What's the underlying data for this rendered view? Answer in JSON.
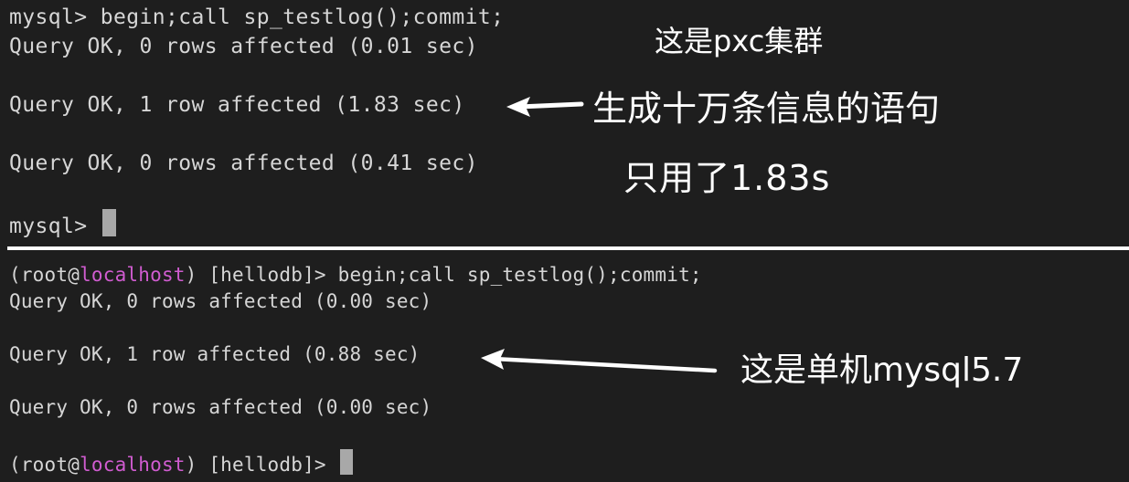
{
  "top_terminal": {
    "prompt": "mysql> ",
    "command": "begin;call sp_testlog();commit;",
    "lines": [
      "Query OK, 0 rows affected (0.01 sec)",
      "Query OK, 1 row affected (1.83 sec)",
      "Query OK, 0 rows affected (0.41 sec)"
    ],
    "final_prompt": "mysql> "
  },
  "bottom_terminal": {
    "prompt_open": "(root@",
    "host": "localhost",
    "prompt_close": ") [hellodb]> ",
    "command": "begin;call sp_testlog();commit;",
    "lines": [
      "Query OK, 0 rows affected (0.00 sec)",
      "Query OK, 1 row affected (0.88 sec)",
      "Query OK, 0 rows affected (0.00 sec)"
    ]
  },
  "annotations": {
    "pxc_cluster": "这是pxc集群",
    "generate_statement": "生成十万条信息的语句",
    "only_used": "只用了1.83s",
    "standalone": "这是单机mysql5.7"
  },
  "colors": {
    "background": "#1e1e1e",
    "terminal_text": "#d6d6d6",
    "host_highlight": "#d05cd0",
    "annotation": "#ffffff",
    "cursor": "#a8a8a8"
  }
}
